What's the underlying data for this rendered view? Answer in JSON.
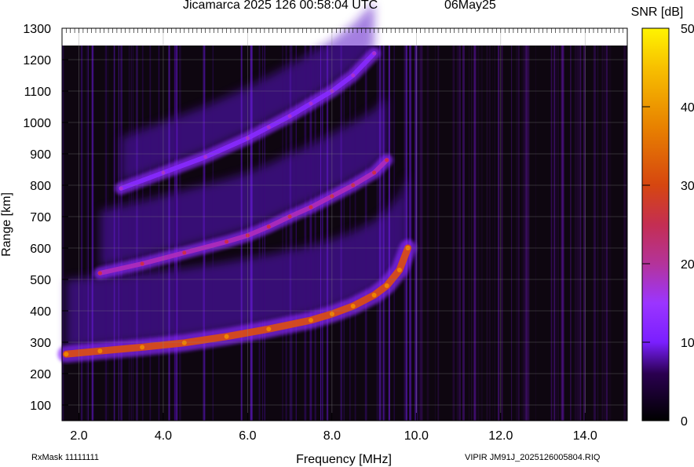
{
  "header": {
    "title": "Jicamarca 2025 126 00:58:04 UTC",
    "date": "06May25"
  },
  "footer": {
    "left": "RxMask 11111111",
    "right": "VIPIR  JM91J_2025126005804.RIQ"
  },
  "chart_data": {
    "type": "heatmap",
    "title": "Jicamarca 2025 126 00:58:04 UTC",
    "subtitle": "06May25",
    "xlabel": "Frequency [MHz]",
    "ylabel": "Range [km]",
    "xlim": [
      1.6,
      15.0
    ],
    "ylim": [
      50,
      1300
    ],
    "xticks": [
      2.0,
      4.0,
      6.0,
      8.0,
      10.0,
      12.0,
      14.0
    ],
    "xtick_labels": [
      "2.0",
      "4.0",
      "6.0",
      "8.0",
      "10.0",
      "12.0",
      "14.0"
    ],
    "yticks": [
      100,
      200,
      300,
      400,
      500,
      600,
      700,
      800,
      900,
      1000,
      1100,
      1200,
      1300
    ],
    "ytick_labels": [
      "100",
      "200",
      "300",
      "400",
      "500",
      "600",
      "700",
      "800",
      "900",
      "1000",
      "1100",
      "1200",
      "1300"
    ],
    "grid": true,
    "colorbar": {
      "label": "SNR [dB]",
      "min": 0,
      "max": 50,
      "ticks": [
        0,
        10,
        20,
        30,
        40,
        50
      ],
      "tick_labels": [
        "0",
        "10",
        "20",
        "30",
        "40",
        "50"
      ],
      "colormap": [
        "#000000",
        "#3a0070",
        "#7a1fff",
        "#9a3aff",
        "#c21f7a",
        "#d43a1a",
        "#e86a00",
        "#f7a800",
        "#fff000"
      ]
    },
    "traces": [
      {
        "x": [
          1.7,
          2.5,
          3.5,
          4.5,
          5.5,
          6.5,
          7.5,
          8.0,
          8.5,
          9.0,
          9.3,
          9.6,
          9.8
        ],
        "y": [
          262,
          272,
          284,
          298,
          318,
          342,
          370,
          390,
          415,
          450,
          480,
          530,
          600
        ],
        "snr": 34
      },
      {
        "x": [
          2.5,
          3.5,
          4.5,
          5.5,
          6.0,
          6.5,
          7.0,
          7.5,
          8.0,
          8.5,
          9.0,
          9.3
        ],
        "y": [
          520,
          550,
          585,
          620,
          640,
          668,
          700,
          730,
          765,
          800,
          840,
          880
        ],
        "snr": 22
      },
      {
        "x": [
          3.0,
          4.0,
          5.0,
          6.0,
          6.5,
          7.0,
          7.5,
          8.0,
          8.5,
          9.0
        ],
        "y": [
          790,
          840,
          890,
          950,
          985,
          1020,
          1060,
          1100,
          1150,
          1220
        ],
        "snr": 15
      }
    ]
  }
}
